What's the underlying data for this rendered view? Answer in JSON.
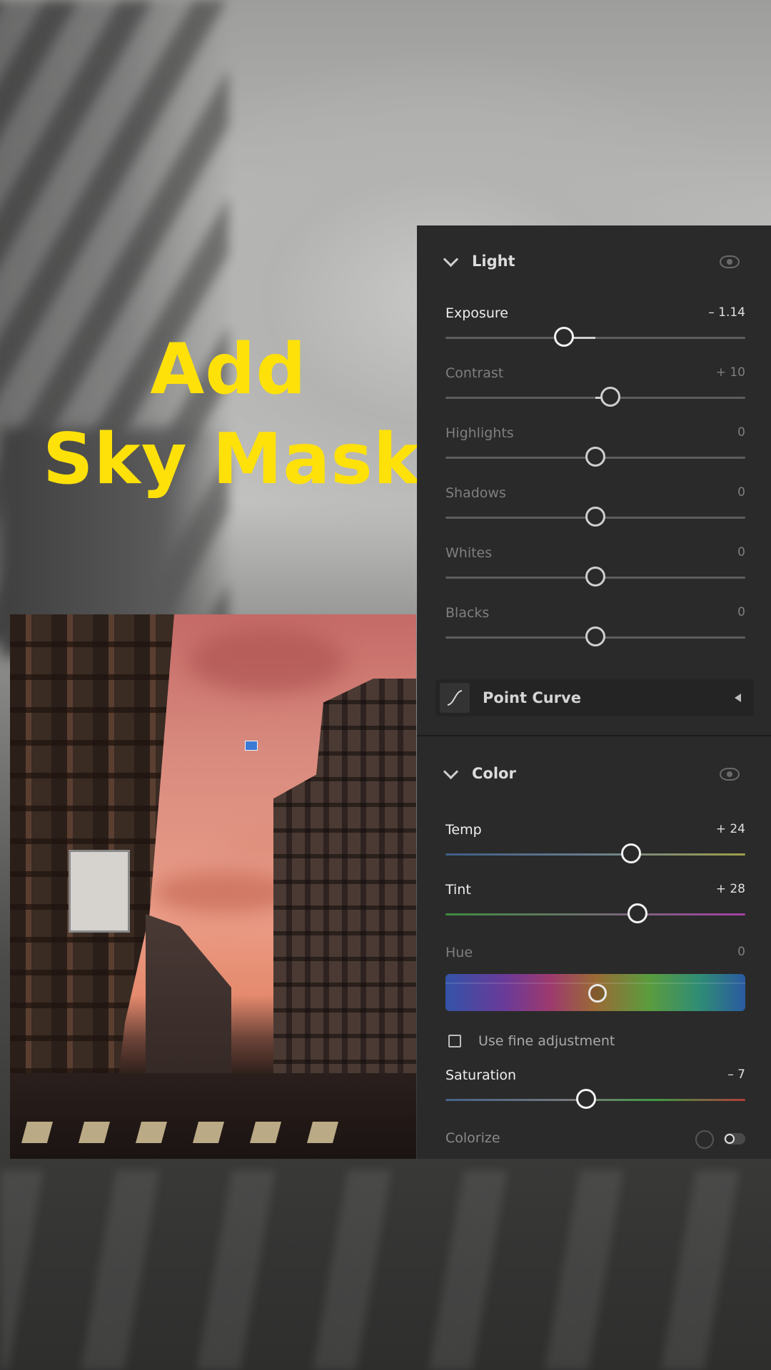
{
  "headline": {
    "line1": "Add",
    "line2": "Sky Mask"
  },
  "light": {
    "title": "Light",
    "sliders": [
      {
        "label": "Exposure",
        "value": "– 1.14",
        "position": 0.395,
        "fill_from": 0.5,
        "active": true
      },
      {
        "label": "Contrast",
        "value": "+ 10",
        "position": 0.55,
        "fill_from": 0.5,
        "active": false
      },
      {
        "label": "Highlights",
        "value": "0",
        "position": 0.5,
        "fill_from": 0.5,
        "active": false
      },
      {
        "label": "Shadows",
        "value": "0",
        "position": 0.5,
        "fill_from": 0.5,
        "active": false
      },
      {
        "label": "Whites",
        "value": "0",
        "position": 0.5,
        "fill_from": 0.5,
        "active": false
      },
      {
        "label": "Blacks",
        "value": "0",
        "position": 0.5,
        "fill_from": 0.5,
        "active": false
      }
    ]
  },
  "point_curve": {
    "label": "Point Curve"
  },
  "color": {
    "title": "Color",
    "temp": {
      "label": "Temp",
      "value": "+ 24",
      "position": 0.62
    },
    "tint": {
      "label": "Tint",
      "value": "+ 28",
      "position": 0.64
    },
    "hue": {
      "label": "Hue",
      "value": "0",
      "position": 0.5
    },
    "fine_adjustment": {
      "label": "Use fine adjustment",
      "checked": false
    },
    "saturation": {
      "label": "Saturation",
      "value": "– 7",
      "position": 0.47
    },
    "colorize": {
      "label": "Colorize"
    }
  },
  "colors": {
    "headline": "#ffe10a",
    "panel": "#2a2a2a"
  }
}
